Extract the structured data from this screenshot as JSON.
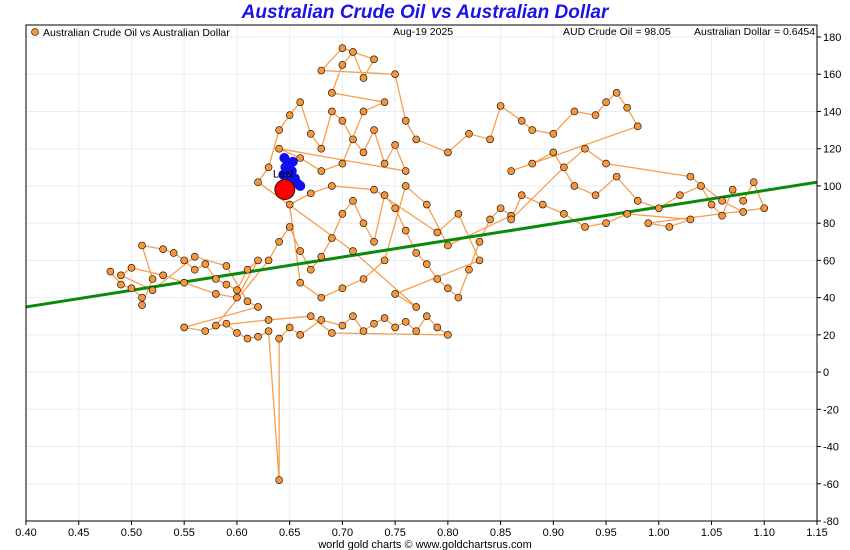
{
  "chart_data": {
    "type": "scatter",
    "title": "Australian Crude Oil vs Australian Dollar",
    "legend": "Australian Crude Oil vs Australian Dollar",
    "legend_placement": "top-left",
    "date": "Aug-19  2025",
    "readout_oil": "AUD Crude Oil = 98.05",
    "readout_aud": "Australian Dollar = 0.6454",
    "footer": "world gold charts © www.goldchartsrus.com",
    "last_label": "Last",
    "xlim": [
      0.4,
      1.15
    ],
    "ylim": [
      -80,
      180
    ],
    "x_ticks": [
      "0.40",
      "0.45",
      "0.50",
      "0.55",
      "0.60",
      "0.65",
      "0.70",
      "0.75",
      "0.80",
      "0.85",
      "0.90",
      "0.95",
      "1.00",
      "1.05",
      "1.10",
      "1.15"
    ],
    "y_ticks": [
      "180",
      "160",
      "140",
      "120",
      "100",
      "80",
      "60",
      "40",
      "20",
      "0",
      "-20",
      "-40",
      "-60",
      "-80"
    ],
    "grid": true,
    "colors": {
      "points": "#f7953b",
      "line": "#f7953b",
      "trend": "#0a8a0a",
      "recent": "#1010ee",
      "last": "#ff0000",
      "title": "#1a14e6"
    },
    "trend_line": [
      [
        0.4,
        35
      ],
      [
        1.15,
        102
      ]
    ],
    "last_point": [
      0.6454,
      98.05
    ],
    "recent_points": [
      [
        0.645,
        115
      ],
      [
        0.648,
        112
      ],
      [
        0.652,
        108
      ],
      [
        0.644,
        106
      ],
      [
        0.655,
        104
      ],
      [
        0.658,
        101
      ],
      [
        0.65,
        103
      ],
      [
        0.646,
        110
      ],
      [
        0.66,
        100
      ],
      [
        0.653,
        113
      ]
    ],
    "points": [
      [
        0.48,
        54
      ],
      [
        0.49,
        47
      ],
      [
        0.5,
        45
      ],
      [
        0.51,
        40
      ],
      [
        0.51,
        36
      ],
      [
        0.52,
        50
      ],
      [
        0.51,
        68
      ],
      [
        0.53,
        66
      ],
      [
        0.54,
        64
      ],
      [
        0.55,
        60
      ],
      [
        0.56,
        55
      ],
      [
        0.57,
        58
      ],
      [
        0.58,
        50
      ],
      [
        0.59,
        47
      ],
      [
        0.6,
        44
      ],
      [
        0.61,
        55
      ],
      [
        0.62,
        60
      ],
      [
        0.6,
        40
      ],
      [
        0.58,
        42
      ],
      [
        0.55,
        48
      ],
      [
        0.53,
        52
      ],
      [
        0.5,
        56
      ],
      [
        0.49,
        52
      ],
      [
        0.52,
        44
      ],
      [
        0.56,
        62
      ],
      [
        0.59,
        57
      ],
      [
        0.61,
        38
      ],
      [
        0.62,
        35
      ],
      [
        0.55,
        24
      ],
      [
        0.57,
        22
      ],
      [
        0.59,
        26
      ],
      [
        0.6,
        21
      ],
      [
        0.61,
        18
      ],
      [
        0.62,
        19
      ],
      [
        0.63,
        22
      ],
      [
        0.64,
        -58
      ],
      [
        0.64,
        18
      ],
      [
        0.65,
        24
      ],
      [
        0.66,
        20
      ],
      [
        0.68,
        28
      ],
      [
        0.7,
        25
      ],
      [
        0.71,
        30
      ],
      [
        0.72,
        22
      ],
      [
        0.73,
        26
      ],
      [
        0.74,
        29
      ],
      [
        0.75,
        24
      ],
      [
        0.76,
        27
      ],
      [
        0.77,
        22
      ],
      [
        0.78,
        30
      ],
      [
        0.79,
        24
      ],
      [
        0.8,
        20
      ],
      [
        0.69,
        21
      ],
      [
        0.67,
        30
      ],
      [
        0.63,
        28
      ],
      [
        0.58,
        25
      ],
      [
        0.63,
        60
      ],
      [
        0.64,
        70
      ],
      [
        0.65,
        78
      ],
      [
        0.66,
        65
      ],
      [
        0.67,
        55
      ],
      [
        0.68,
        62
      ],
      [
        0.69,
        72
      ],
      [
        0.7,
        85
      ],
      [
        0.71,
        92
      ],
      [
        0.72,
        80
      ],
      [
        0.73,
        70
      ],
      [
        0.74,
        95
      ],
      [
        0.75,
        88
      ],
      [
        0.76,
        76
      ],
      [
        0.77,
        64
      ],
      [
        0.78,
        58
      ],
      [
        0.79,
        50
      ],
      [
        0.8,
        45
      ],
      [
        0.81,
        40
      ],
      [
        0.82,
        55
      ],
      [
        0.83,
        70
      ],
      [
        0.84,
        82
      ],
      [
        0.85,
        88
      ],
      [
        0.86,
        84
      ],
      [
        0.8,
        68
      ],
      [
        0.78,
        90
      ],
      [
        0.76,
        100
      ],
      [
        0.74,
        60
      ],
      [
        0.72,
        50
      ],
      [
        0.7,
        45
      ],
      [
        0.68,
        40
      ],
      [
        0.66,
        48
      ],
      [
        0.65,
        90
      ],
      [
        0.67,
        96
      ],
      [
        0.69,
        100
      ],
      [
        0.73,
        98
      ],
      [
        0.79,
        75
      ],
      [
        0.81,
        85
      ],
      [
        0.83,
        60
      ],
      [
        0.75,
        42
      ],
      [
        0.77,
        35
      ],
      [
        0.71,
        65
      ],
      [
        0.62,
        102
      ],
      [
        0.63,
        110
      ],
      [
        0.64,
        130
      ],
      [
        0.65,
        138
      ],
      [
        0.66,
        145
      ],
      [
        0.67,
        128
      ],
      [
        0.68,
        120
      ],
      [
        0.69,
        140
      ],
      [
        0.7,
        135
      ],
      [
        0.71,
        125
      ],
      [
        0.72,
        118
      ],
      [
        0.73,
        130
      ],
      [
        0.74,
        112
      ],
      [
        0.75,
        122
      ],
      [
        0.76,
        108
      ],
      [
        0.64,
        120
      ],
      [
        0.66,
        115
      ],
      [
        0.68,
        108
      ],
      [
        0.7,
        112
      ],
      [
        0.72,
        140
      ],
      [
        0.74,
        145
      ],
      [
        0.69,
        150
      ],
      [
        0.7,
        165
      ],
      [
        0.71,
        172
      ],
      [
        0.72,
        158
      ],
      [
        0.73,
        168
      ],
      [
        0.7,
        174
      ],
      [
        0.68,
        162
      ],
      [
        0.75,
        160
      ],
      [
        0.76,
        135
      ],
      [
        0.77,
        125
      ],
      [
        0.8,
        118
      ],
      [
        0.82,
        128
      ],
      [
        0.84,
        125
      ],
      [
        0.85,
        143
      ],
      [
        0.87,
        135
      ],
      [
        0.88,
        130
      ],
      [
        0.9,
        128
      ],
      [
        0.92,
        140
      ],
      [
        0.94,
        138
      ],
      [
        0.95,
        145
      ],
      [
        0.96,
        150
      ],
      [
        0.97,
        142
      ],
      [
        0.98,
        132
      ],
      [
        0.86,
        108
      ],
      [
        0.88,
        112
      ],
      [
        0.9,
        118
      ],
      [
        0.92,
        100
      ],
      [
        0.94,
        95
      ],
      [
        0.96,
        105
      ],
      [
        0.98,
        92
      ],
      [
        1.0,
        88
      ],
      [
        1.02,
        95
      ],
      [
        1.04,
        100
      ],
      [
        1.05,
        90
      ],
      [
        1.06,
        84
      ],
      [
        1.07,
        98
      ],
      [
        1.08,
        92
      ],
      [
        1.09,
        102
      ],
      [
        1.1,
        88
      ],
      [
        0.99,
        80
      ],
      [
        1.01,
        78
      ],
      [
        1.03,
        82
      ],
      [
        0.97,
        85
      ],
      [
        0.95,
        80
      ],
      [
        0.93,
        78
      ],
      [
        0.91,
        85
      ],
      [
        0.89,
        90
      ],
      [
        0.87,
        95
      ],
      [
        0.86,
        82
      ],
      [
        0.91,
        110
      ],
      [
        0.93,
        120
      ],
      [
        0.95,
        112
      ],
      [
        1.03,
        105
      ],
      [
        1.06,
        92
      ],
      [
        1.08,
        86
      ]
    ]
  }
}
